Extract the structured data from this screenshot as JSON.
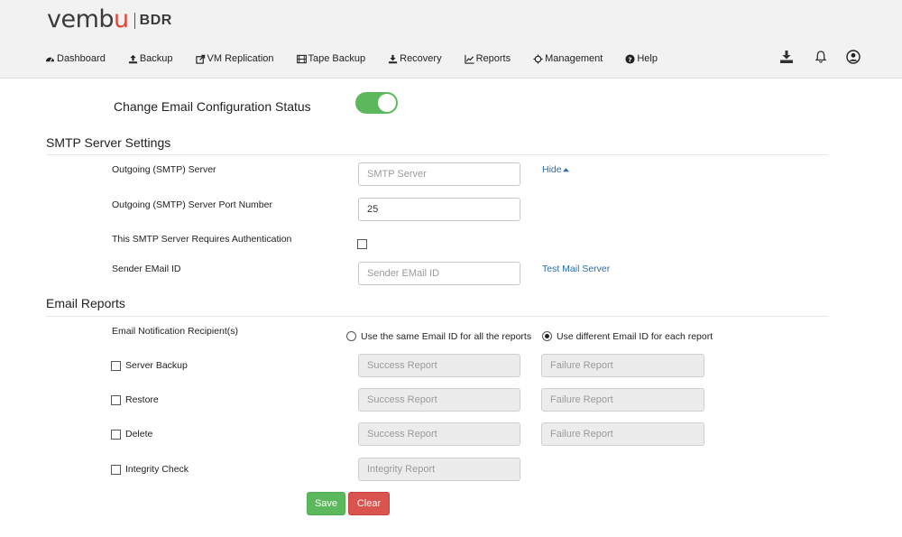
{
  "brand": {
    "name_prefix": "vemb",
    "name_accent": "u",
    "product": "BDR",
    "accent_color": "#e0463a"
  },
  "nav": [
    {
      "label": "Dashboard",
      "icon": "dashboard-icon"
    },
    {
      "label": "Backup",
      "icon": "upload-icon"
    },
    {
      "label": "VM Replication",
      "icon": "share-icon"
    },
    {
      "label": "Tape Backup",
      "icon": "film-icon"
    },
    {
      "label": "Recovery",
      "icon": "download-icon"
    },
    {
      "label": "Reports",
      "icon": "line-chart-icon"
    },
    {
      "label": "Management",
      "icon": "crosshair-icon"
    },
    {
      "label": "Help",
      "icon": "question-circle-icon"
    }
  ],
  "header_icons": [
    "download-icon",
    "bell-icon",
    "user-icon"
  ],
  "toggle": {
    "label": "Change Email Configuration Status",
    "on": true,
    "color": "#5cb85c"
  },
  "smtp": {
    "title": "SMTP Server Settings",
    "server_label": "Outgoing (SMTP) Server",
    "server_placeholder": "SMTP Server",
    "server_value": "",
    "hide_link": "Hide",
    "port_label": "Outgoing (SMTP) Server Port Number",
    "port_value": "25",
    "auth_label": "This SMTP Server Requires Authentication",
    "auth_checked": false,
    "sender_label": "Sender EMail ID",
    "sender_placeholder": "Sender EMail ID",
    "sender_value": "",
    "test_link": "Test Mail Server",
    "link_color": "#2a6cad"
  },
  "reports": {
    "title": "Email Reports",
    "recipients_label": "Email Notification Recipient(s)",
    "option_same": "Use the same Email ID for all the reports",
    "option_different": "Use different Email ID for each report",
    "selected_option": "different",
    "rows": [
      {
        "label": "Server Backup",
        "checked": false,
        "success_placeholder": "Success Report",
        "failure_placeholder": "Failure Report"
      },
      {
        "label": "Restore",
        "checked": false,
        "success_placeholder": "Success Report",
        "failure_placeholder": "Failure Report"
      },
      {
        "label": "Delete",
        "checked": false,
        "success_placeholder": "Success Report",
        "failure_placeholder": "Failure Report"
      },
      {
        "label": "Integrity Check",
        "checked": false,
        "report_placeholder": "Integrity Report"
      }
    ]
  },
  "actions": {
    "save": "Save",
    "clear": "Clear",
    "save_color": "#5cb85c",
    "clear_color": "#d9534f"
  }
}
